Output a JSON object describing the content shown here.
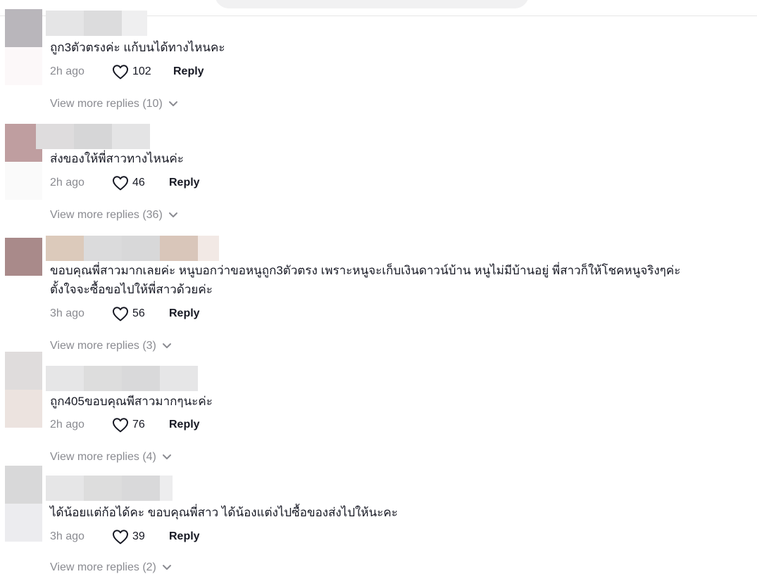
{
  "comments": [
    {
      "text": [
        "ถูก3ตัวตรงค่ะ แก้บนได้ทางไหนคะ"
      ],
      "time": "2h ago",
      "likes": "102",
      "reply_label": "Reply",
      "view_more": "View more replies (10)"
    },
    {
      "text": [
        "ส่งของให้พี่สาวทางไหนค่ะ"
      ],
      "time": "2h ago",
      "likes": "46",
      "reply_label": "Reply",
      "view_more": "View more replies (36)"
    },
    {
      "text": [
        "ขอบคุณพี่สาวมากเลยค่ะ หนูบอกว่าขอหนูถูก3ตัวตรง เพราะหนูจะเก็บเงินดาวน์บ้าน หนูไม่มีบ้านอยู่ พี่สาวก็ให้โชคหนูจริงๆค่ะ",
        "ตั้งใจจะซื้อขอไปให้พี่สาวด้วยค่ะ"
      ],
      "time": "3h ago",
      "likes": "56",
      "reply_label": "Reply",
      "view_more": "View more replies (3)"
    },
    {
      "text": [
        "ถูก405ขอบคุณพีสาวมากๆนะค่ะ"
      ],
      "time": "2h ago",
      "likes": "76",
      "reply_label": "Reply",
      "view_more": "View more replies (4)"
    },
    {
      "text": [
        "ได้น้อยแต่ก้อได้คะ ขอบคุณพี่สาว ได้น้องแต่งไปซื้อของส่งไปให้นะคะ"
      ],
      "time": "3h ago",
      "likes": "39",
      "reply_label": "Reply",
      "view_more": "View more replies (2)"
    }
  ],
  "icons": {
    "like": "heart-outline-icon",
    "expand": "chevron-down-icon"
  },
  "colors": {
    "text": "#161823",
    "muted": "#8a8b91",
    "divider": "#e6e6e6"
  }
}
